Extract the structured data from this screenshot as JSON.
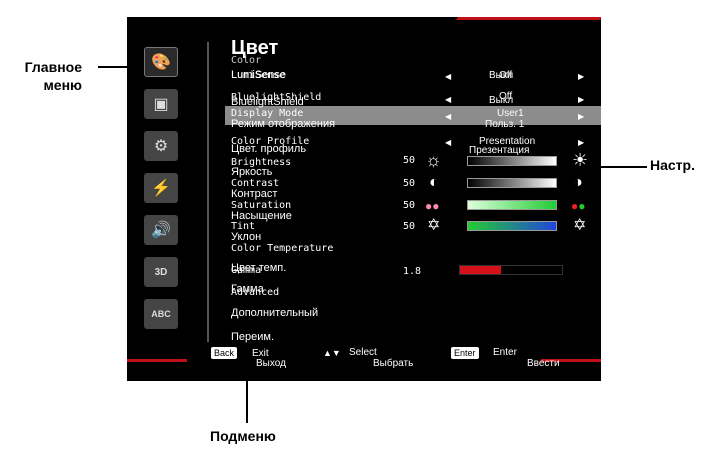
{
  "callouts": {
    "main_menu": "Главное меню",
    "main_menu_l1": "Главное",
    "main_menu_l2": "меню",
    "submenu": "Подменю",
    "settings": "Настр."
  },
  "menu": {
    "title": "Цвет",
    "title_en": "Color",
    "rows": [
      {
        "en": "LumiSense",
        "ru": "LumiSense",
        "value_en": "Off",
        "value_ru": "Выкл"
      },
      {
        "en": "BluelightShield",
        "ru": "BluelightShield",
        "value_en": "Off",
        "value_ru": "Выкл"
      },
      {
        "en": "Display Mode",
        "ru": "Режим отображения",
        "value_en": "User1",
        "value_ru": "Польз. 1"
      },
      {
        "en": "Color Profile",
        "ru": "Цвет. профиль",
        "value_en": "Presentation",
        "value_ru": "Презентация"
      },
      {
        "en": "Brightness",
        "ru": "Яркость",
        "number": "50",
        "level": 0.5
      },
      {
        "en": "Contrast",
        "ru": "Контраст",
        "number": "50",
        "level": 0.5
      },
      {
        "en": "Saturation",
        "ru": "Насыщение",
        "number": "50",
        "level": 0.5
      },
      {
        "en": "Tint",
        "ru": "Уклон",
        "number": "50",
        "level": 0.5
      },
      {
        "en": "Color Temperature",
        "ru": "Цвет темп."
      },
      {
        "en": "Gamma",
        "ru": "Гамма",
        "number": "1.8",
        "level": 0.4
      },
      {
        "en": "Advanced",
        "ru": "Дополнительный"
      },
      {
        "en": "",
        "ru": "Переим."
      }
    ]
  },
  "footer": {
    "back_key": "Back",
    "back_en": "Exit",
    "back_ru": "Выход",
    "select_en": "Select",
    "select_ru": "Выбрать",
    "enter_key": "Enter",
    "enter_en": "Enter",
    "enter_ru": "Ввести"
  },
  "sidebar_icons": [
    "palette-icon",
    "image-icon",
    "gear-icon",
    "power-icon",
    "audio-icon",
    "3d-icon",
    "language-icon"
  ],
  "sidebar_icon_labels": {
    "abc": "ABC",
    "3d": "3D"
  },
  "colors": {
    "highlight": "#8c8c8c",
    "accent_red": "#c0101a",
    "gamma_red": "#d4101a"
  }
}
